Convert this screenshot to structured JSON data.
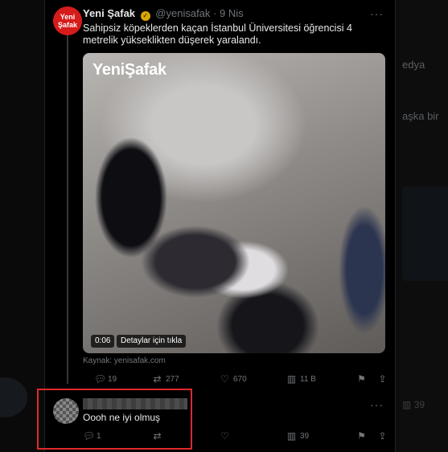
{
  "background": {
    "text_top": "edya",
    "text_mid": "aşka bir",
    "views": "39"
  },
  "tweet": {
    "avatar_line1": "Yeni",
    "avatar_line2": "Şafak",
    "name": "Yeni Şafak",
    "handle": "@yenisafak",
    "separator": "·",
    "date": "9 Nis",
    "text": "Sahipsiz köpeklerden kaçan İstanbul Üniversitesi öğrencisi 4 metrelik yükseklikten düşerek yaralandı.",
    "media": {
      "logo": "YeniŞafak",
      "duration": "0:06",
      "details": "Detaylar için tıkla"
    },
    "source": "Kaynak: yenisafak.com",
    "stats": {
      "replies": "19",
      "reposts": "277",
      "likes": "670",
      "views": "11 B"
    }
  },
  "reply": {
    "text": "Oooh ne iyi olmuş",
    "stats": {
      "replies": "1",
      "views": "39"
    }
  },
  "colors": {
    "highlight": "#e0292a",
    "brand": "#d71b1b",
    "verified": "#d9a500"
  }
}
